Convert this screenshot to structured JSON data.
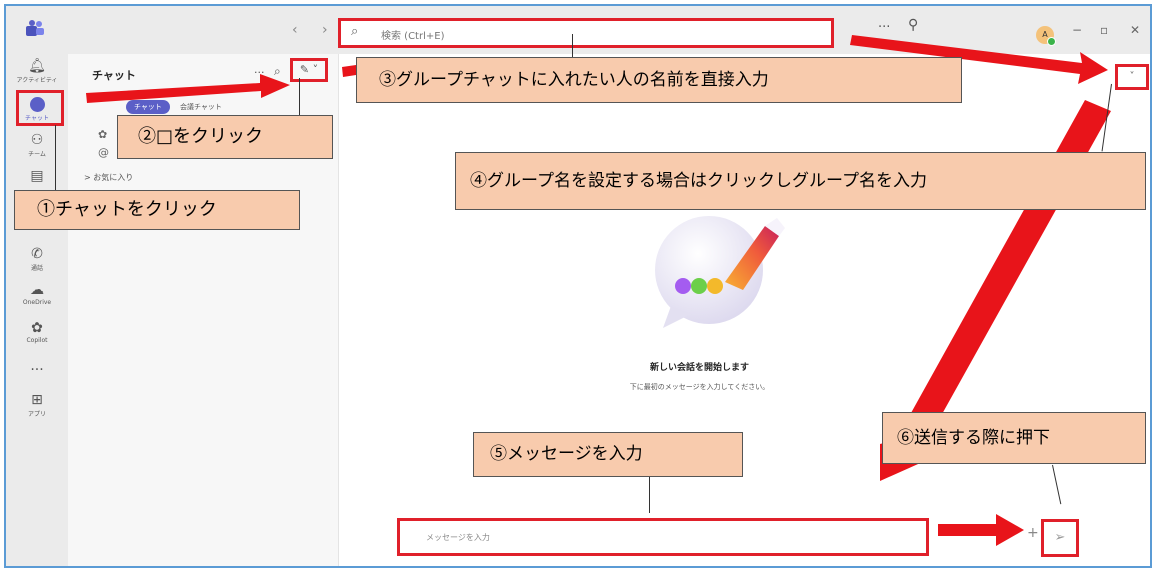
{
  "titlebar": {
    "search_placeholder": "検索 (Ctrl+E)",
    "more": "···",
    "avatar_initial": "A",
    "minimize": "−",
    "restore": "▫",
    "close": "✕"
  },
  "rail": {
    "items": [
      {
        "label": "アクティビティ",
        "icon": "bell-icon"
      },
      {
        "label": "チャット",
        "icon": "chat-icon"
      },
      {
        "label": "チーム",
        "icon": "teams-icon"
      },
      {
        "label": "通話",
        "icon": "phone-icon"
      },
      {
        "label": "OneDrive",
        "icon": "cloud-icon"
      },
      {
        "label": "Copilot",
        "icon": "copilot-icon"
      },
      {
        "label": "アプリ",
        "icon": "apps-icon"
      }
    ],
    "more": "···"
  },
  "chatlist": {
    "title": "チャット",
    "more": "···",
    "tabs": [
      "チャット",
      "会議チャット"
    ],
    "favorites": "> お気に入り"
  },
  "main": {
    "heading": "新しい会話を開始します",
    "subtext": "下に最初のメッセージを入力してください。",
    "message_placeholder": "メッセージを入力",
    "plus": "+"
  },
  "callouts": {
    "c1": "①チャットをクリック",
    "c2": "②□をクリック",
    "c3": "③グループチャットに入れたい人の名前を直接入力",
    "c4": "④グループ名を設定する場合はクリックしグループ名を入力",
    "c5": "⑤メッセージを入力",
    "c6": "⑥送信する際に押下"
  },
  "colors": {
    "highlight_red": "#e0202a",
    "callout_fill": "#f8cbad",
    "teams_purple": "#5b5fc7"
  }
}
